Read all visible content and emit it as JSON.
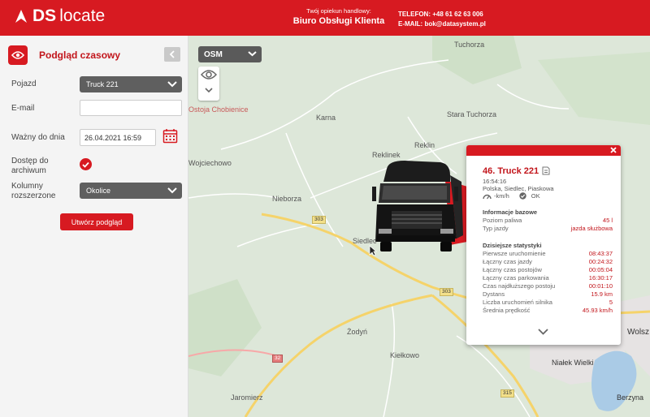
{
  "header": {
    "logo_ds": "DS",
    "logo_locate": "locate",
    "opiekun_label": "Twój opiekun handlowy:",
    "opiekun_name": "Biuro Obsługi Klienta",
    "phone": "TELEFON: +48 61 62 63 006",
    "email": "E-MAIL: bok@datasystem.pl"
  },
  "panel": {
    "title": "Podgląd czasowy",
    "fields": {
      "vehicle_label": "Pojazd",
      "vehicle_value": "Truck 221",
      "email_label": "E-mail",
      "email_value": "",
      "valid_label": "Ważny do dnia",
      "valid_value": "26.04.2021  16:59",
      "archive_label_1": "Dostęp do",
      "archive_label_2": "archiwum",
      "columns_label_1": "Kolumny",
      "columns_label_2": "rozszerzone",
      "columns_value": "Okolice"
    },
    "create_button": "Utwórz podgląd"
  },
  "map": {
    "layer": "OSM",
    "places": {
      "tuchorza": "Tuchorza",
      "ostoja": "Ostoja Chobienice",
      "karna": "Karna",
      "stara_tuchorza": "Stara Tuchorza",
      "reklinek": "Reklinek",
      "reklin": "Reklin",
      "wojciechowo": "Wojciechowo",
      "nieborza": "Nieborza",
      "siedlec": "Siedlec",
      "zodyn": "Żodyń",
      "kielkowo": "Kiełkowo",
      "jaromierz": "Jaromierz",
      "wolsz": "Wolsz",
      "nialek": "Niałek Wielki",
      "berzyna": "Berzyna"
    },
    "roads": {
      "r303a": "303",
      "r303b": "303",
      "r32": "32",
      "r315": "315"
    }
  },
  "popup": {
    "title": "46. Truck 221",
    "time": "16:54:16",
    "location": "Polska, Siedlec, Piaskowa",
    "speed": "-km/h",
    "status": "OK",
    "base_header": "Informacje bazowe",
    "base": [
      {
        "label": "Poziom paliwa",
        "value": "45 l"
      },
      {
        "label": "Typ jazdy",
        "value": "jazda służbowa"
      }
    ],
    "stats_header": "Dzisiejsze statystyki",
    "stats": [
      {
        "label": "Pierwsze uruchomienie",
        "value": "08:43:37"
      },
      {
        "label": "Łączny czas jazdy",
        "value": "00:24:32"
      },
      {
        "label": "Łączny czas postojów",
        "value": "00:05:04"
      },
      {
        "label": "Łączny czas parkowania",
        "value": "16:30:17"
      },
      {
        "label": "Czas najdłuższego postoju",
        "value": "00:01:10"
      },
      {
        "label": "Dystans",
        "value": "15.9 km"
      },
      {
        "label": "Liczba uruchomień silnika",
        "value": "5"
      },
      {
        "label": "Średnia prędkość",
        "value": "45.93 km/h"
      }
    ]
  },
  "colors": {
    "brand_red": "#d71a21",
    "panel_bg": "#f4f4f4",
    "map_bg": "#dde7d9"
  }
}
